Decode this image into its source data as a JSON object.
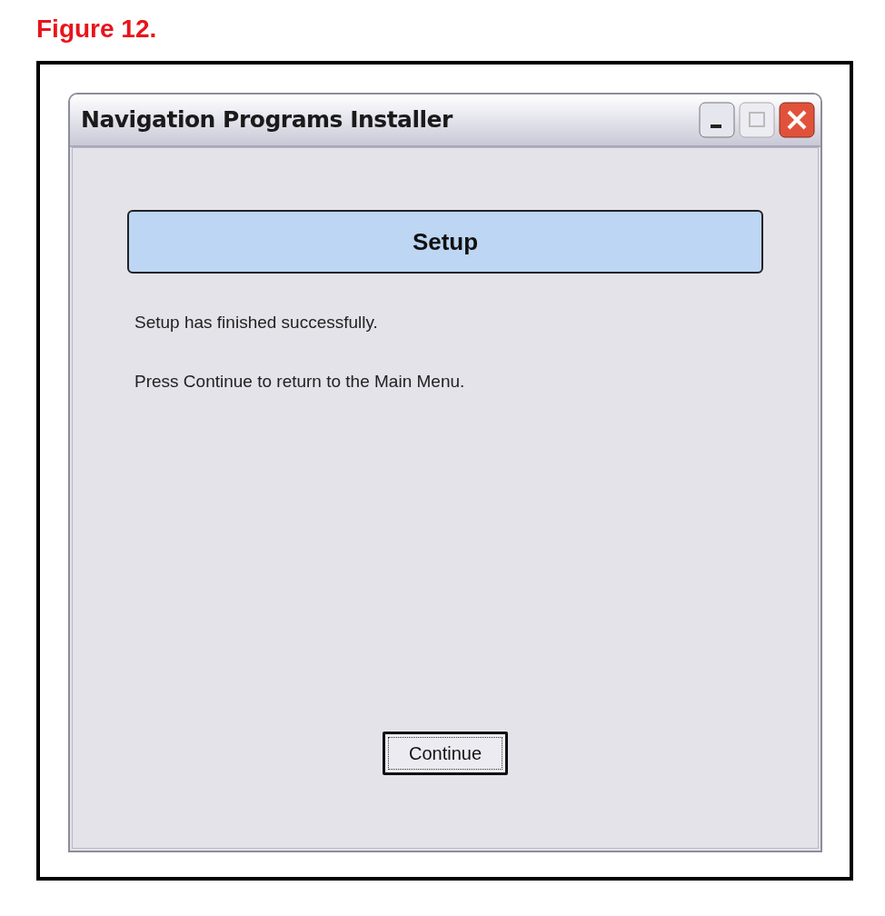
{
  "figure_caption": "Figure 12.",
  "window": {
    "title": "Navigation Programs Installer"
  },
  "header": "Setup",
  "messages": [
    "Setup has finished successfully.",
    "Press Continue to return to the Main Menu."
  ],
  "buttons": [
    {
      "label": "Continue",
      "focused": true
    }
  ]
}
